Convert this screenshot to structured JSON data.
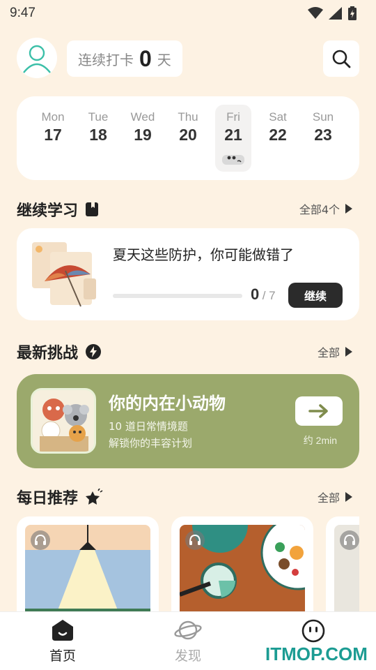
{
  "status_bar": {
    "time": "9:47"
  },
  "header": {
    "streak_label": "连续打卡",
    "streak_count": "0",
    "streak_unit": "天"
  },
  "week": {
    "days": [
      {
        "name": "Mon",
        "num": "17"
      },
      {
        "name": "Tue",
        "num": "18"
      },
      {
        "name": "Wed",
        "num": "19"
      },
      {
        "name": "Thu",
        "num": "20"
      },
      {
        "name": "Fri",
        "num": "21"
      },
      {
        "name": "Sat",
        "num": "22"
      },
      {
        "name": "Sun",
        "num": "23"
      }
    ],
    "active_index": 4
  },
  "continue_learning": {
    "title": "继续学习",
    "more": "全部4个",
    "course_title": "夏天这些防护，你可能做错了",
    "progress_done": "0",
    "progress_total": "/ 7",
    "progress_fraction": 0,
    "button": "继续"
  },
  "challenge": {
    "section_title": "最新挑战",
    "more": "全部",
    "title": "你的内在小动物",
    "sub1": "10 道日常情境题",
    "sub2": "解锁你的丰容计划",
    "time": "约 2min",
    "accent": "#9ba96c"
  },
  "daily": {
    "title": "每日推荐",
    "more": "全部"
  },
  "tabs": [
    {
      "label": "首页",
      "active": true
    },
    {
      "label": "发现",
      "active": false
    },
    {
      "label": "",
      "active": false
    }
  ],
  "watermark": "ITMOP.COM"
}
